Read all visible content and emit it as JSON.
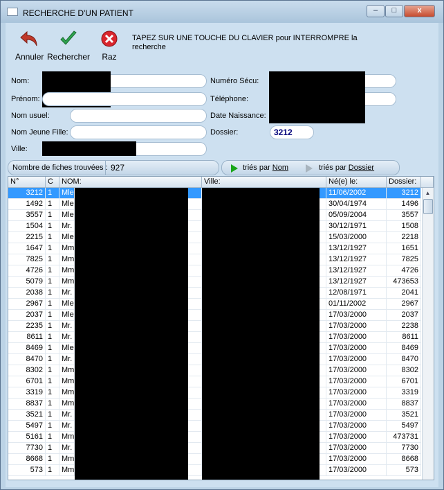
{
  "window": {
    "title": "RECHERCHE D'UN PATIENT",
    "minimize": "–",
    "maximize": "□",
    "close": "x"
  },
  "toolbar": {
    "cancel_label": "Annuler",
    "search_label": "Rechercher",
    "reset_label": "Raz",
    "message": "TAPEZ SUR UNE TOUCHE DU CLAVIER pour INTERROMPRE la recherche"
  },
  "form": {
    "nom_label": "Nom:",
    "nom_value": "",
    "prenom_label": "Prénom:",
    "prenom_value": "",
    "nom_usuel_label": "Nom usuel:",
    "nom_usuel_value": "",
    "nom_jeune_fille_label": "Nom Jeune Fille:",
    "nom_jeune_fille_value": "",
    "ville_label": "Ville:",
    "ville_value": "",
    "secu_label": "Numéro Sécu:",
    "secu_value": "",
    "telephone_label": "Téléphone:",
    "telephone_value": "",
    "date_naissance_label": "Date Naissance:",
    "date_naissance_value": "",
    "dossier_label": "Dossier:",
    "dossier_value": "3212"
  },
  "results": {
    "count_label": "Nombre de fiches trouvées :",
    "count_value": "927",
    "sort_nom_prefix": "triés par ",
    "sort_nom_key": "Nom",
    "sort_dossier_prefix": "triés par ",
    "sort_dossier_key": "Dossier"
  },
  "table": {
    "columns": [
      "N°",
      "C",
      "NOM:",
      "Ville:",
      "Né(e) le:",
      "Dossier:"
    ],
    "rows": [
      {
        "num": "3212",
        "c": "1",
        "civ": "Mle",
        "date": "11/06/2002",
        "dossier": "3212",
        "selected": true
      },
      {
        "num": "1492",
        "c": "1",
        "civ": "Mle",
        "date": "30/04/1974",
        "dossier": "1496"
      },
      {
        "num": "3557",
        "c": "1",
        "civ": "Mle",
        "date": "05/09/2004",
        "dossier": "3557"
      },
      {
        "num": "1504",
        "c": "1",
        "civ": "Mr.",
        "date": "30/12/1971",
        "dossier": "1508"
      },
      {
        "num": "2215",
        "c": "1",
        "civ": "Mle",
        "date": "15/03/2000",
        "dossier": "2218"
      },
      {
        "num": "1647",
        "c": "1",
        "civ": "Mm",
        "date": "13/12/1927",
        "dossier": "1651"
      },
      {
        "num": "7825",
        "c": "1",
        "civ": "Mm",
        "date": "13/12/1927",
        "dossier": "7825"
      },
      {
        "num": "4726",
        "c": "1",
        "civ": "Mm",
        "date": "13/12/1927",
        "dossier": "4726"
      },
      {
        "num": "5079",
        "c": "1",
        "civ": "Mm",
        "date": "13/12/1927",
        "dossier": "473653"
      },
      {
        "num": "2038",
        "c": "1",
        "civ": "Mr.",
        "date": "12/08/1971",
        "dossier": "2041"
      },
      {
        "num": "2967",
        "c": "1",
        "civ": "Mle",
        "date": "01/11/2002",
        "dossier": "2967"
      },
      {
        "num": "2037",
        "c": "1",
        "civ": "Mle",
        "date": "17/03/2000",
        "dossier": "2037"
      },
      {
        "num": "2235",
        "c": "1",
        "civ": "Mr.",
        "date": "17/03/2000",
        "dossier": "2238"
      },
      {
        "num": "8611",
        "c": "1",
        "civ": "Mr.",
        "date": "17/03/2000",
        "dossier": "8611"
      },
      {
        "num": "8469",
        "c": "1",
        "civ": "Mle",
        "date": "17/03/2000",
        "dossier": "8469"
      },
      {
        "num": "8470",
        "c": "1",
        "civ": "Mr.",
        "date": "17/03/2000",
        "dossier": "8470"
      },
      {
        "num": "8302",
        "c": "1",
        "civ": "Mm",
        "date": "17/03/2000",
        "dossier": "8302"
      },
      {
        "num": "6701",
        "c": "1",
        "civ": "Mm",
        "date": "17/03/2000",
        "dossier": "6701"
      },
      {
        "num": "3319",
        "c": "1",
        "civ": "Mm",
        "date": "17/03/2000",
        "dossier": "3319"
      },
      {
        "num": "8837",
        "c": "1",
        "civ": "Mm",
        "date": "17/03/2000",
        "dossier": "8837"
      },
      {
        "num": "3521",
        "c": "1",
        "civ": "Mr.",
        "date": "17/03/2000",
        "dossier": "3521"
      },
      {
        "num": "5497",
        "c": "1",
        "civ": "Mr.",
        "date": "17/03/2000",
        "dossier": "5497"
      },
      {
        "num": "5161",
        "c": "1",
        "civ": "Mm",
        "date": "17/03/2000",
        "dossier": "473731"
      },
      {
        "num": "7730",
        "c": "1",
        "civ": "Mr.",
        "date": "17/03/2000",
        "dossier": "7730"
      },
      {
        "num": "8668",
        "c": "1",
        "civ": "Mm",
        "date": "17/03/2000",
        "dossier": "8668"
      },
      {
        "num": "573",
        "c": "1",
        "civ": "Mm",
        "date": "17/03/2000",
        "dossier": "573"
      }
    ]
  },
  "colors": {
    "selection": "#3399ff",
    "cancel_icon": "#c0392b",
    "search_icon": "#2ea44f",
    "reset_icon": "#d9262e",
    "play_icon": "#1aa61a"
  }
}
